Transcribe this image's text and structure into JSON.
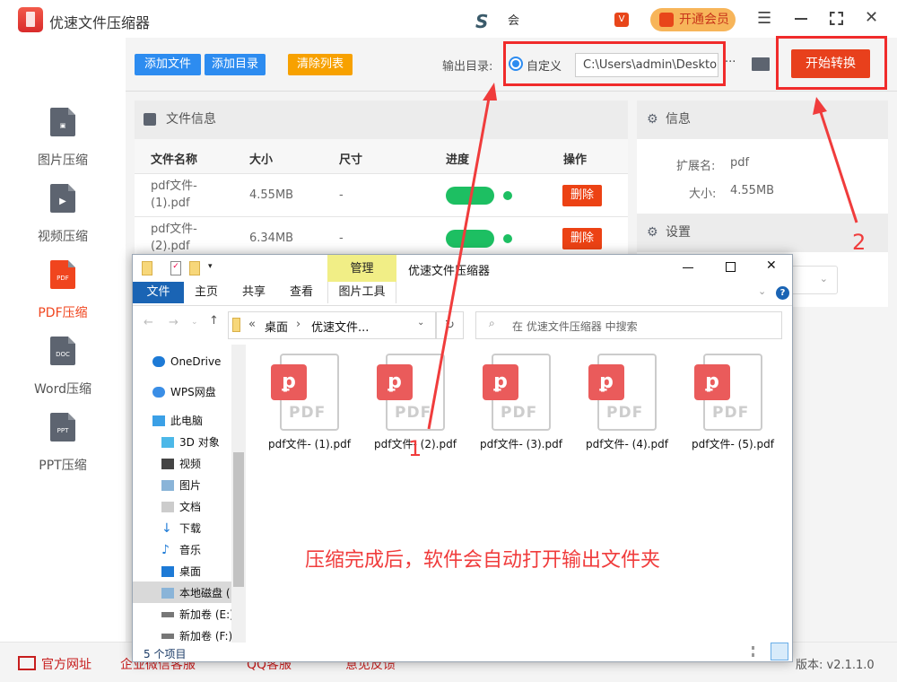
{
  "app": {
    "title": "优速文件压缩器",
    "user_label": "会",
    "vip_button": "开通会员"
  },
  "sidebar": {
    "items": [
      {
        "label": "图片压缩",
        "icon": "image-file-icon"
      },
      {
        "label": "视频压缩",
        "icon": "video-file-icon"
      },
      {
        "label": "PDF压缩",
        "icon": "pdf-file-icon",
        "badge": "PDF",
        "active": true
      },
      {
        "label": "Word压缩",
        "icon": "doc-file-icon",
        "badge": "DOC"
      },
      {
        "label": "PPT压缩",
        "icon": "ppt-file-icon",
        "badge": "PPT"
      }
    ]
  },
  "toolbar": {
    "add_file": "添加文件",
    "add_dir": "添加目录",
    "clear_list": "清除列表",
    "output_label": "输出目录:",
    "radio_label": "自定义",
    "output_path": "C:\\Users\\admin\\Deskto",
    "more": "···",
    "start": "开始转换"
  },
  "files_panel": {
    "title": "文件信息",
    "columns": [
      "文件名称",
      "大小",
      "尺寸",
      "进度",
      "操作"
    ],
    "rows": [
      {
        "name1": "pdf文件-",
        "name2": "(1).pdf",
        "size": "4.55MB",
        "dim": "-",
        "progress": 100,
        "action": "删除"
      },
      {
        "name1": "pdf文件-",
        "name2": "(2).pdf",
        "size": "6.34MB",
        "dim": "-",
        "progress": 100,
        "action": "删除"
      }
    ]
  },
  "info_panel": {
    "title": "信息",
    "ext_label": "扩展名:",
    "ext_value": "pdf",
    "size_label": "大小:",
    "size_value": "4.55MB",
    "settings_title": "设置"
  },
  "footer": {
    "items": [
      "官方网址",
      "企业微信客服",
      "QQ客服",
      "意见反馈"
    ],
    "version": "版本: v2.1.1.0"
  },
  "explorer": {
    "manage_tab": "管理",
    "title": "优速文件压缩器",
    "tabs": [
      "文件",
      "主页",
      "共享",
      "查看",
      "图片工具"
    ],
    "breadcrumb": [
      "«",
      "桌面",
      "›",
      "优速文件..."
    ],
    "search_placeholder": "在 优速文件压缩器 中搜索",
    "nav": [
      "OneDrive",
      "WPS网盘",
      "此电脑",
      "3D 对象",
      "视频",
      "图片",
      "文档",
      "下载",
      "音乐",
      "桌面",
      "本地磁盘 (",
      "新加卷 (E:)",
      "新加卷 (F:)"
    ],
    "files": [
      "pdf文件- (1).pdf",
      "pdf文件- (2).pdf",
      "pdf文件- (3).pdf",
      "pdf文件- (4).pdf",
      "pdf文件- (5).pdf"
    ],
    "file_badge": "PDF",
    "status": "5 个项目"
  },
  "annotations": {
    "caption": "压缩完成后，软件会自动打开输出文件夹",
    "marker1": "1",
    "marker2": "2",
    "color": "#f03c3c"
  }
}
